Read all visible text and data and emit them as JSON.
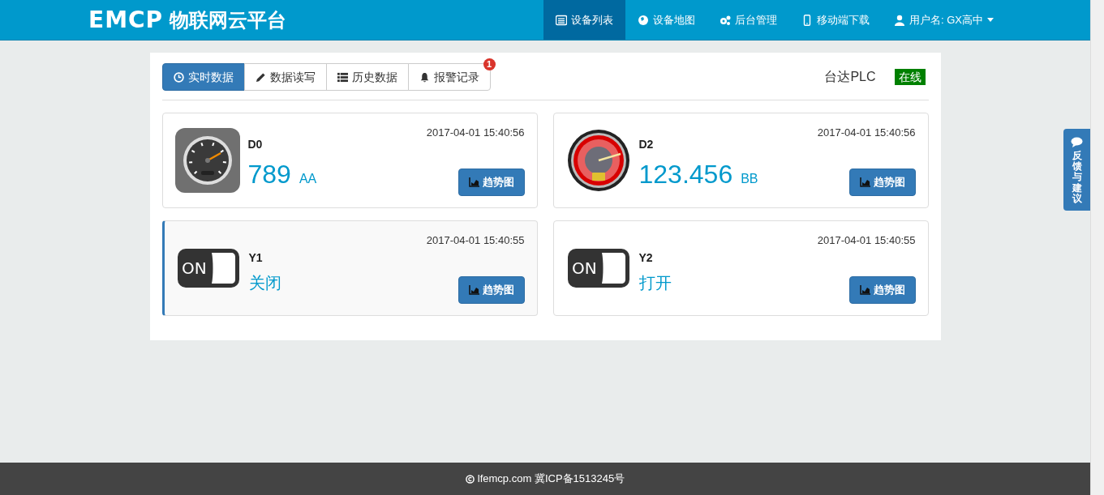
{
  "header": {
    "logo": "EMCP",
    "title": "物联网云平台",
    "nav": [
      {
        "label": "设备列表",
        "selected": true
      },
      {
        "label": "设备地图",
        "selected": false
      },
      {
        "label": "后台管理",
        "selected": false
      },
      {
        "label": "移动端下载",
        "selected": false
      },
      {
        "label": "用户名: GX高中",
        "selected": false,
        "dropdown": true
      }
    ]
  },
  "tabs": [
    {
      "label": "实时数据",
      "selected": true
    },
    {
      "label": "数据读写",
      "selected": false
    },
    {
      "label": "历史数据",
      "selected": false
    },
    {
      "label": "报警记录",
      "selected": false,
      "badge": "1"
    }
  ],
  "device": {
    "name": "台达PLC",
    "status": "在线"
  },
  "cards": [
    {
      "kind": "dark-gauge",
      "name": "D0",
      "time": "2017-04-01 15:40:56",
      "value": "789",
      "unit": "AA",
      "button": "趋势图",
      "highlighted": false
    },
    {
      "kind": "red-gauge",
      "name": "D2",
      "time": "2017-04-01 15:40:56",
      "value": "123.456",
      "unit": "BB",
      "button": "趋势图",
      "highlighted": false
    },
    {
      "kind": "toggle",
      "toggle_text": "ON",
      "name": "Y1",
      "time": "2017-04-01 15:40:55",
      "value": "关闭",
      "button": "趋势图",
      "highlighted": true
    },
    {
      "kind": "toggle",
      "toggle_text": "ON",
      "name": "Y2",
      "time": "2017-04-01 15:40:55",
      "value": "打开",
      "button": "趋势图",
      "highlighted": false
    }
  ],
  "feedback": "反馈与建议",
  "footer": {
    "text": "lfemcp.com 冀ICP备1513245号"
  }
}
